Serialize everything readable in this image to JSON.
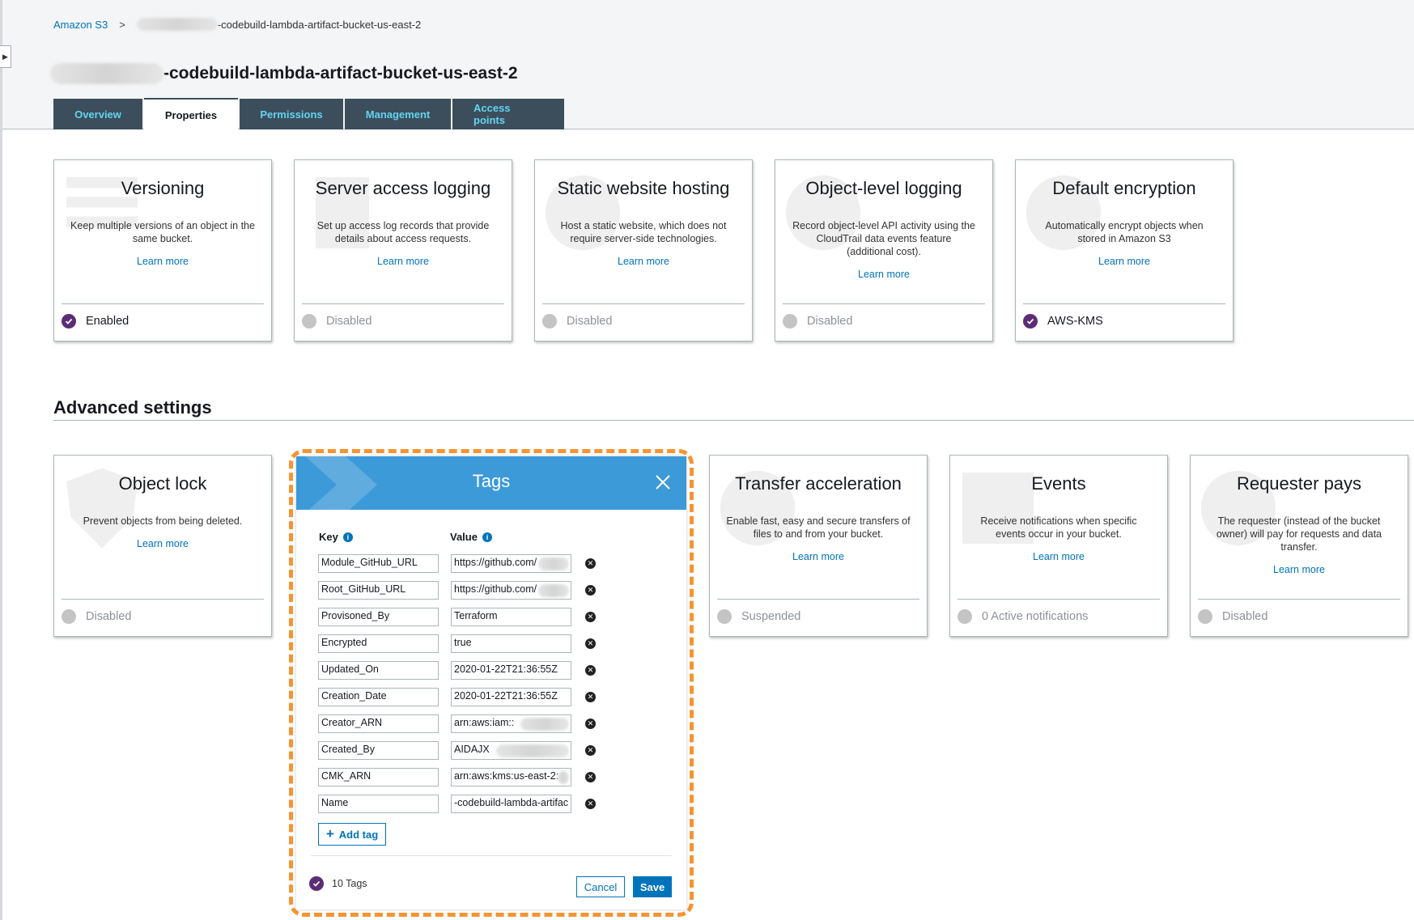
{
  "breadcrumb": {
    "root": "Amazon S3",
    "bucket": "-codebuild-lambda-artifact-bucket-us-east-2"
  },
  "bucket_title": "-codebuild-lambda-artifact-bucket-us-east-2",
  "tabs": [
    {
      "label": "Overview",
      "active": false
    },
    {
      "label": "Properties",
      "active": true
    },
    {
      "label": "Permissions",
      "active": false
    },
    {
      "label": "Management",
      "active": false
    },
    {
      "label": "Access points",
      "active": false
    }
  ],
  "properties": [
    {
      "title": "Versioning",
      "description": "Keep multiple versions of an object in the same bucket.",
      "link": "Learn more",
      "status": "Enabled",
      "enabled": true
    },
    {
      "title": "Server access logging",
      "description": "Set up access log records that provide details about access requests.",
      "link": "Learn more",
      "status": "Disabled",
      "enabled": false
    },
    {
      "title": "Static website hosting",
      "description": "Host a static website, which does not require server-side technologies.",
      "link": "Learn more",
      "status": "Disabled",
      "enabled": false
    },
    {
      "title": "Object-level logging",
      "description": "Record object-level API activity using the CloudTrail data events feature (additional cost).",
      "link": "Learn more",
      "status": "Disabled",
      "enabled": false
    },
    {
      "title": "Default encryption",
      "description": "Automatically encrypt objects when stored in Amazon S3",
      "link": "Learn more",
      "status": "AWS-KMS",
      "enabled": true
    }
  ],
  "advanced": {
    "heading": "Advanced settings",
    "cards": [
      {
        "title": "Object lock",
        "description": "Prevent objects from being deleted.",
        "link": "Learn more",
        "status": "Disabled",
        "enabled": false
      },
      {
        "title": "Transfer acceleration",
        "description": "Enable fast, easy and secure transfers of files to and from your bucket.",
        "link": "Learn more",
        "status": "Suspended",
        "enabled": false
      },
      {
        "title": "Events",
        "description": "Receive notifications when specific events occur in your bucket.",
        "link": "Learn more",
        "status": "0 Active notifications",
        "enabled": false
      },
      {
        "title": "Requester pays",
        "description": "The requester (instead of the bucket owner) will pay for requests and data transfer.",
        "link": "Learn more",
        "status": "Disabled",
        "enabled": false
      }
    ]
  },
  "tags_panel": {
    "title": "Tags",
    "key_header": "Key",
    "value_header": "Value",
    "rows": [
      {
        "key": "Module_GitHub_URL",
        "value": "https://github.com/",
        "redacted": true
      },
      {
        "key": "Root_GitHub_URL",
        "value": "https://github.com/",
        "redacted": true
      },
      {
        "key": "Provisoned_By",
        "value": "Terraform",
        "redacted": false
      },
      {
        "key": "Encrypted",
        "value": "true",
        "redacted": false
      },
      {
        "key": "Updated_On",
        "value": "2020-01-22T21:36:55Z",
        "redacted": false
      },
      {
        "key": "Creation_Date",
        "value": "2020-01-22T21:36:55Z",
        "redacted": false
      },
      {
        "key": "Creator_ARN",
        "value": "arn:aws:iam::",
        "redacted": true
      },
      {
        "key": "Created_By",
        "value": "AIDAJX",
        "redacted": true
      },
      {
        "key": "CMK_ARN",
        "value": "arn:aws:kms:us-east-2:",
        "redacted": true
      },
      {
        "key": "Name",
        "value": "-codebuild-lambda-artifac",
        "redacted": false
      }
    ],
    "add_tag_label": "Add tag",
    "count_label": "10 Tags",
    "cancel_label": "Cancel",
    "save_label": "Save"
  },
  "colors": {
    "accent_blue": "#0073bb",
    "tab_bg": "#3c4e5c",
    "tab_text": "#63d3f0",
    "tags_header": "#3d9ad8",
    "enabled_purple": "#5d2c77",
    "highlight_orange": "#f59431"
  }
}
